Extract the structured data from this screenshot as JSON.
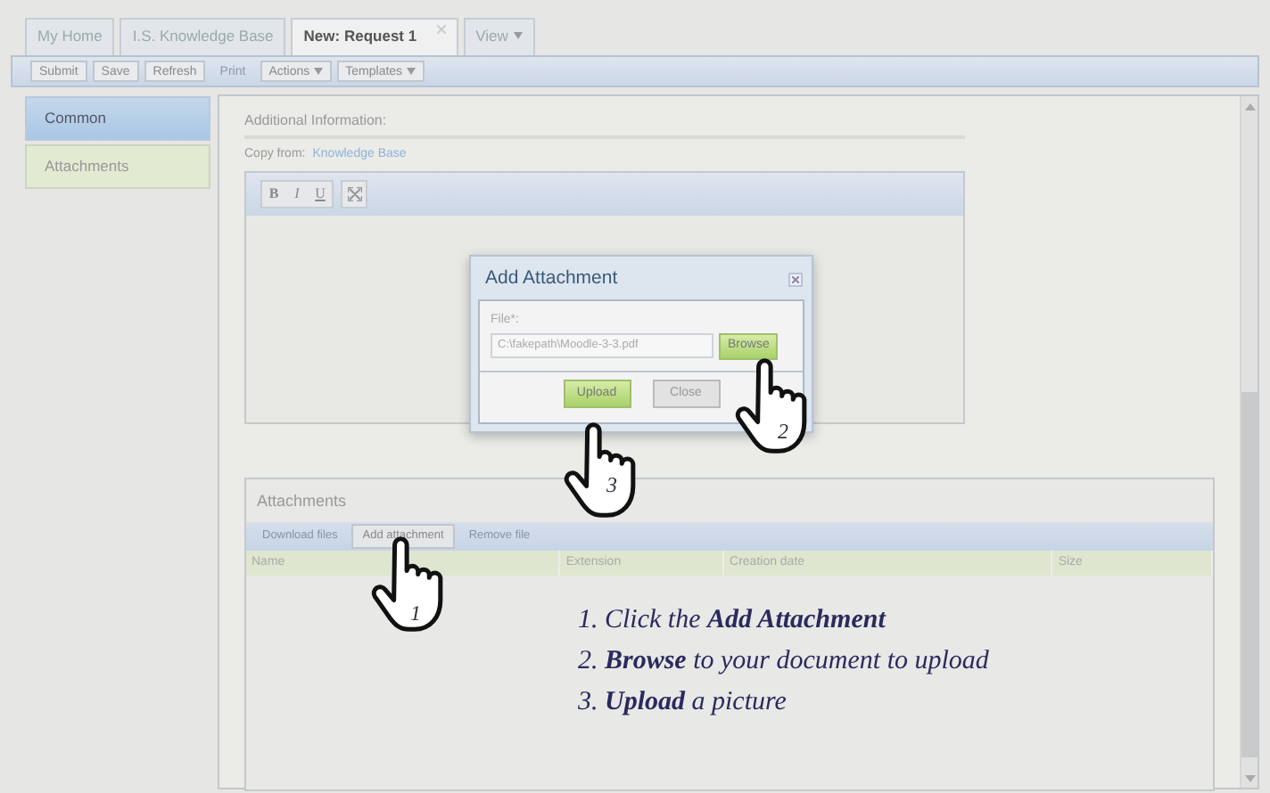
{
  "tabs": [
    {
      "label": "My Home",
      "selected": false,
      "closable": false,
      "dropdown": false
    },
    {
      "label": "I.S. Knowledge Base",
      "selected": false,
      "closable": false,
      "dropdown": false
    },
    {
      "label": "New: Request 1",
      "selected": true,
      "closable": true,
      "dropdown": false
    },
    {
      "label": "View",
      "selected": false,
      "closable": false,
      "dropdown": true
    }
  ],
  "toolbar": [
    {
      "label": "Submit",
      "disabled": false,
      "dropdown": false
    },
    {
      "label": "Save",
      "disabled": false,
      "dropdown": false
    },
    {
      "label": "Refresh",
      "disabled": false,
      "dropdown": false
    },
    {
      "label": "Print",
      "disabled": true,
      "dropdown": false
    },
    {
      "label": "Actions",
      "disabled": false,
      "dropdown": true
    },
    {
      "label": "Templates",
      "disabled": false,
      "dropdown": true
    }
  ],
  "sidebar": {
    "items": [
      {
        "label": "Common",
        "selected": true
      },
      {
        "label": "Attachments",
        "selected": false
      }
    ]
  },
  "form": {
    "section_title": "Additional Information:",
    "copy_from_label": "Copy from:",
    "copy_from_link": "Knowledge Base",
    "editor_buttons": [
      {
        "kind": "bold",
        "label": "B"
      },
      {
        "kind": "italic",
        "label": "I"
      },
      {
        "kind": "underline",
        "label": "U"
      },
      {
        "kind": "fullscreen"
      }
    ]
  },
  "dialog": {
    "title": "Add Attachment",
    "field_label": "File*:",
    "field_value": "C:\\fakepath\\Moodle-3-3.pdf",
    "browse_button": "Browse",
    "buttons": [
      {
        "label": "Upload",
        "kind": "primary"
      },
      {
        "label": "Close",
        "kind": "plain"
      }
    ]
  },
  "attachments": {
    "title": "Attachments",
    "buttons": [
      {
        "label": "Download files",
        "disabled": true
      },
      {
        "label": "Add attachment",
        "disabled": false
      },
      {
        "label": "Remove file",
        "disabled": true
      }
    ],
    "columns": [
      "Name",
      "Extension",
      "Creation date",
      "Size"
    ]
  },
  "instructions": [
    "1. Click the **Add Attachment**",
    "2. **Browse** to your document to upload",
    "3. **Upload** a picture"
  ],
  "pointers": [
    {
      "number": "1"
    },
    {
      "number": "2"
    },
    {
      "number": "3"
    }
  ]
}
